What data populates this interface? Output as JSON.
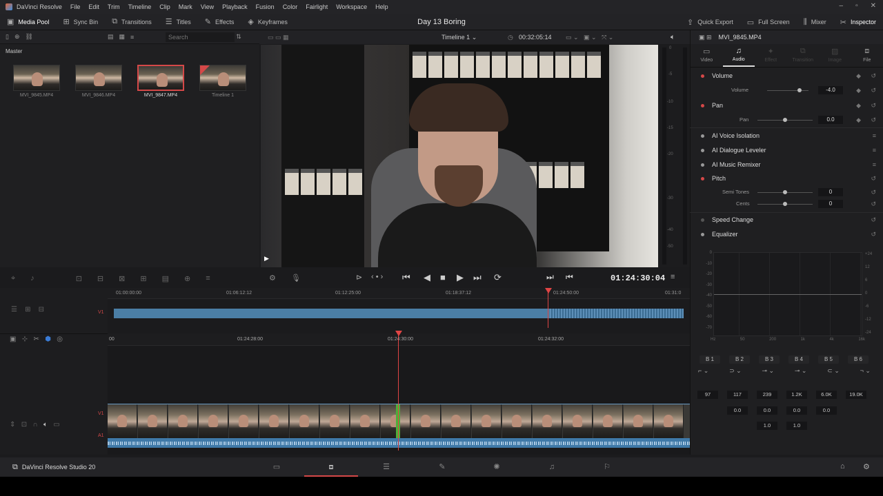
{
  "menu": {
    "app_name": "DaVinci Resolve",
    "items": [
      "File",
      "Edit",
      "Trim",
      "Timeline",
      "Clip",
      "Mark",
      "View",
      "Playback",
      "Fusion",
      "Color",
      "Fairlight",
      "Workspace",
      "Help"
    ]
  },
  "toolbar": {
    "media_pool": "Media Pool",
    "sync_bin": "Sync Bin",
    "transitions": "Transitions",
    "titles": "Titles",
    "effects": "Effects",
    "keyframes": "Keyframes",
    "project_title": "Day 13 Boring",
    "quick_export": "Quick Export",
    "full_screen": "Full Screen",
    "mixer": "Mixer",
    "inspector": "Inspector"
  },
  "media_pool": {
    "search_placeholder": "Search",
    "bin": "Master",
    "clips": [
      {
        "name": "MVI_9845.MP4",
        "selected": false
      },
      {
        "name": "MVI_9846.MP4",
        "selected": false
      },
      {
        "name": "MVI_9847.MP4",
        "selected": true
      },
      {
        "name": "Timeline 1",
        "selected": false
      }
    ]
  },
  "viewer": {
    "timeline_name": "Timeline 1",
    "duration": "00:32:05:14",
    "timecode": "01:24:30:04",
    "meter_labels": [
      "0",
      "-5",
      "-10",
      "-15",
      "-20",
      "-30",
      "-40",
      "-50"
    ]
  },
  "inspector": {
    "clip_name": "MVI_9845.MP4",
    "tabs": [
      {
        "label": "Video",
        "active": false,
        "enabled": true
      },
      {
        "label": "Audio",
        "active": true,
        "enabled": true
      },
      {
        "label": "Effect",
        "active": false,
        "enabled": false
      },
      {
        "label": "Transition",
        "active": false,
        "enabled": false
      },
      {
        "label": "Image",
        "active": false,
        "enabled": false
      },
      {
        "label": "File",
        "active": false,
        "enabled": true
      }
    ],
    "volume": {
      "title": "Volume",
      "label": "Volume",
      "value": "-4.0",
      "level": 0.78
    },
    "pan": {
      "title": "Pan",
      "label": "Pan",
      "value": "0.0",
      "level": 0.5
    },
    "ai_voice": "AI Voice Isolation",
    "ai_dialogue": "AI Dialogue Leveler",
    "ai_music": "AI Music Remixer",
    "pitch": {
      "title": "Pitch",
      "semitones_label": "Semi Tones",
      "semitones": "0",
      "cents_label": "Cents",
      "cents": "0"
    },
    "speed_change": "Speed Change",
    "equalizer": {
      "title": "Equalizer",
      "db_ticks": [
        "+24",
        "12",
        "6",
        "0",
        "-6",
        "-12",
        "-24"
      ],
      "left_ticks": [
        "0",
        "-10",
        "-20",
        "-30",
        "-40",
        "-50",
        "-60",
        "-70",
        "-80"
      ],
      "freq_ticks": [
        "Hz",
        "50",
        "200",
        "1k",
        "4k",
        "16k"
      ],
      "bands": [
        "B 1",
        "B 2",
        "B 3",
        "B 4",
        "B 5",
        "B 6"
      ],
      "freq": [
        "97",
        "117",
        "239",
        "1.2K",
        "6.0K",
        "19.0K"
      ],
      "gain": [
        "0.0",
        "0.0",
        "0.0",
        "0.0"
      ],
      "q": [
        "1.0",
        "1.0"
      ]
    }
  },
  "timeline": {
    "upper_ruler": [
      "01:00:00:00",
      "01:06:12:12",
      "01:12:25:00",
      "01:18:37:12",
      "01:24:50:00",
      "01:31:0"
    ],
    "lower_ruler": [
      "00",
      "01:24:28:00",
      "01:24:30:00",
      "01:24:32:00"
    ],
    "track_v1": "V1",
    "track_a1": "A1"
  },
  "footer": {
    "app_label": "DaVinci Resolve Studio 20"
  }
}
